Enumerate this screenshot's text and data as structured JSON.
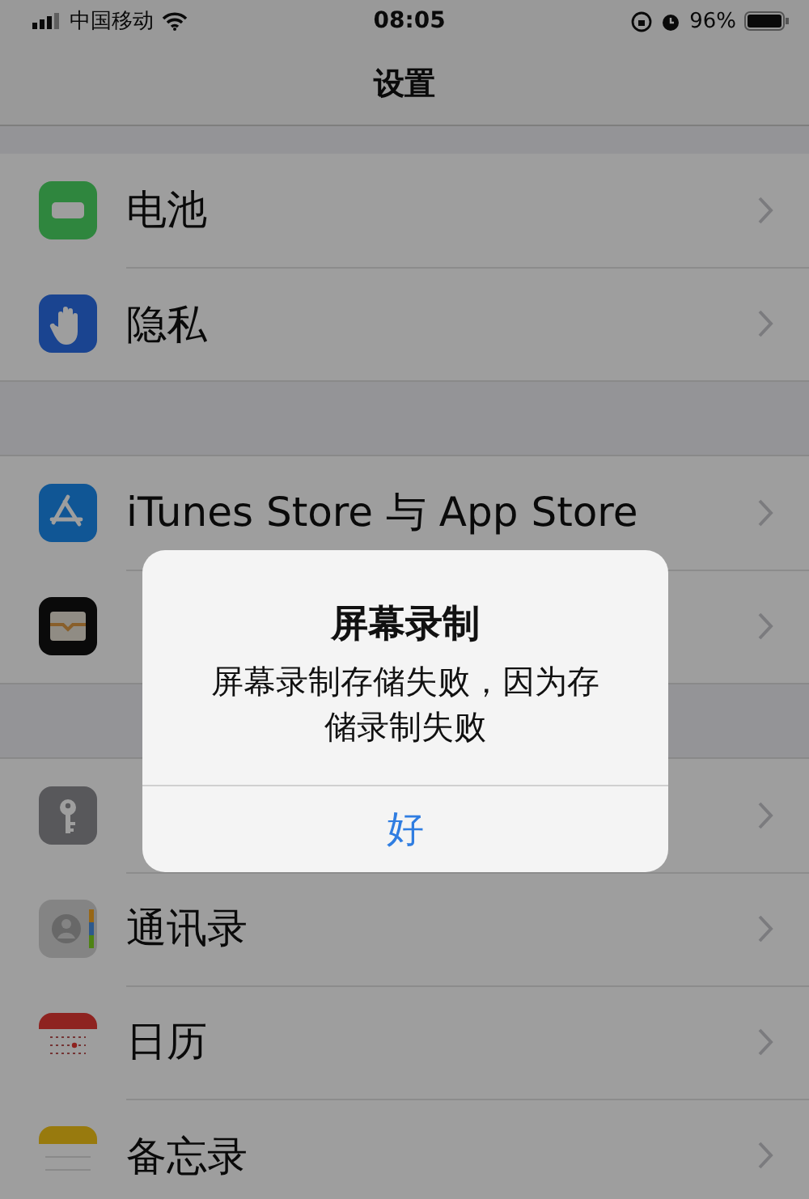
{
  "status_bar": {
    "carrier": "中国移动",
    "time": "08:05",
    "battery": "96%"
  },
  "nav": {
    "title": "设置"
  },
  "sections": [
    {
      "rows": [
        {
          "kind": "battery",
          "label": "电池"
        },
        {
          "kind": "privacy",
          "label": "隐私"
        }
      ]
    },
    {
      "rows": [
        {
          "kind": "appstore",
          "label": "iTunes Store 与 App Store"
        },
        {
          "kind": "wallet"
        }
      ]
    },
    {
      "rows": [
        {
          "kind": "key"
        },
        {
          "kind": "contacts",
          "label": "通讯录"
        },
        {
          "kind": "calendar",
          "label": "日历"
        },
        {
          "kind": "notes",
          "label": "备忘录"
        }
      ]
    }
  ],
  "alert": {
    "title": "屏幕录制",
    "message": "屏幕录制存储失败，因为存储录制失败",
    "buttons": [
      "好"
    ]
  }
}
